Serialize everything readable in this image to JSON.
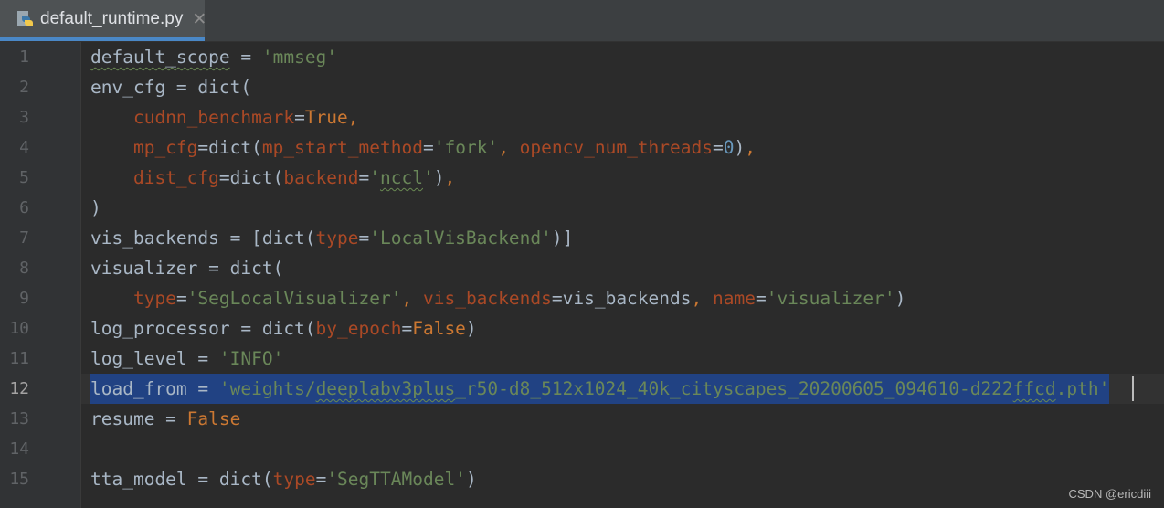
{
  "tab": {
    "filename": "default_runtime.py",
    "icon": "python-file-icon",
    "close_glyph": "✕"
  },
  "gutter": {
    "line_numbers": [
      "1",
      "2",
      "3",
      "4",
      "5",
      "6",
      "7",
      "8",
      "9",
      "10",
      "11",
      "12",
      "13",
      "14",
      "15"
    ],
    "current_line": "12"
  },
  "code": {
    "l1": {
      "a": "default_scope",
      "b": " = ",
      "c": "'mmseg'"
    },
    "l2": {
      "a": "env_cfg = dict("
    },
    "l3": {
      "a": "    ",
      "b": "cudnn_benchmark",
      "c": "=",
      "d": "True",
      "e": ","
    },
    "l4": {
      "a": "    ",
      "b": "mp_cfg",
      "c": "=dict(",
      "d": "mp_start_method",
      "e": "=",
      "f": "'fork'",
      "g": ", ",
      "h": "opencv_num_threads",
      "i": "=",
      "j": "0",
      "k": ")",
      "l": ","
    },
    "l5": {
      "a": "    ",
      "b": "dist_cfg",
      "c": "=dict(",
      "d": "backend",
      "e": "=",
      "f": "'",
      "g": "nccl",
      "h": "'",
      "i": ")",
      "j": ","
    },
    "l6": {
      "a": ")"
    },
    "l7": {
      "a": "vis_backends = [dict(",
      "b": "type",
      "c": "=",
      "d": "'LocalVisBackend'",
      "e": ")]"
    },
    "l8": {
      "a": "visualizer = dict("
    },
    "l9": {
      "a": "    ",
      "b": "type",
      "c": "=",
      "d": "'SegLocalVisualizer'",
      "e": ", ",
      "f": "vis_backends",
      "g": "=vis_backends",
      "h": ", ",
      "i": "name",
      "j": "=",
      "k": "'visualizer'",
      "l": ")"
    },
    "l10": {
      "a": "log_processor = dict(",
      "b": "by_epoch",
      "c": "=",
      "d": "False",
      "e": ")"
    },
    "l11": {
      "a": "log_level = ",
      "b": "'INFO'"
    },
    "l12": {
      "a": "load_from = ",
      "b": "'weights/",
      "c": "deeplabv3plus",
      "d": "_r50-d8_512x1024_40k_cityscapes_20200605_094610-d222",
      "e": "ffcd",
      "f": ".pth'"
    },
    "l13": {
      "a": "resume = ",
      "b": "False"
    },
    "l14": {
      "a": ""
    },
    "l15": {
      "a": "tta_model = dict(",
      "b": "type",
      "c": "=",
      "d": "'SegTTAModel'",
      "e": ")"
    }
  },
  "watermark": "CSDN @ericdiii",
  "colors": {
    "background": "#2b2b2b",
    "selection": "#214283",
    "keyword": "#cc7832",
    "string": "#6a8759",
    "kwarg": "#aa4926",
    "number": "#6897bb",
    "text": "#a9b7c6"
  }
}
